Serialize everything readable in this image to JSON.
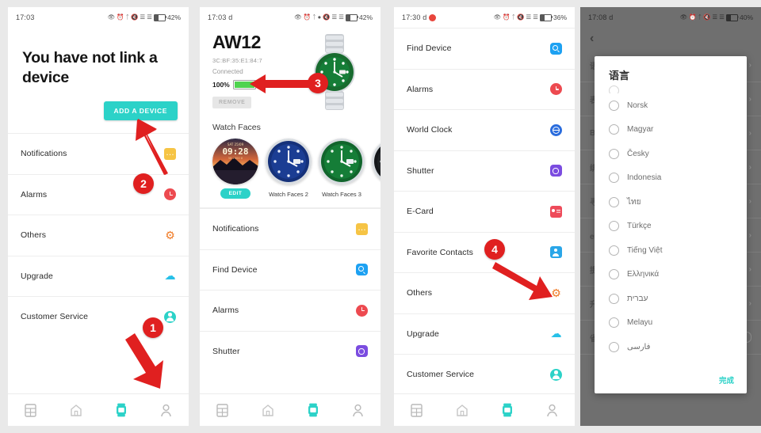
{
  "accent": "#2cd2c8",
  "annotation_color": "#e02020",
  "panel1": {
    "statusbar": {
      "time": "17:03",
      "battery": "42%"
    },
    "headline": "You have not link a device",
    "add_button": "ADD A DEVICE",
    "rows": [
      {
        "label": "Notifications",
        "icon": "notifications-icon"
      },
      {
        "label": "Alarms",
        "icon": "alarm-clock-icon"
      },
      {
        "label": "Others",
        "icon": "gear-icon"
      },
      {
        "label": "Upgrade",
        "icon": "cloud-upload-icon"
      },
      {
        "label": "Customer Service",
        "icon": "person-support-icon"
      }
    ],
    "annotations": [
      {
        "number": "1"
      },
      {
        "number": "2"
      }
    ]
  },
  "panel2": {
    "statusbar": {
      "time": "17:03 d",
      "battery": "42%"
    },
    "device": {
      "name": "AW12",
      "mac": "3C:BF:35:E1:84:7",
      "status": "Connected",
      "battery_percent": "100%",
      "remove_button": "REMOVE"
    },
    "watch_faces_title": "Watch Faces",
    "watch_faces": [
      {
        "caption": "EDIT",
        "is_edit": true,
        "style": "sunset"
      },
      {
        "caption": "Watch Faces 2",
        "is_edit": false,
        "style": "blue"
      },
      {
        "caption": "Watch Faces 3",
        "is_edit": false,
        "style": "green"
      },
      {
        "caption": "W",
        "is_edit": false,
        "style": "dark"
      }
    ],
    "rows": [
      {
        "label": "Notifications",
        "icon": "notifications-icon"
      },
      {
        "label": "Find Device",
        "icon": "find-device-icon"
      },
      {
        "label": "Alarms",
        "icon": "alarm-clock-icon"
      },
      {
        "label": "Shutter",
        "icon": "camera-shutter-icon"
      }
    ],
    "annotations": [
      {
        "number": "3"
      }
    ]
  },
  "panel3": {
    "statusbar": {
      "time": "17:30 d",
      "battery": "36%"
    },
    "rows": [
      {
        "label": "Find Device",
        "icon": "find-device-icon"
      },
      {
        "label": "Alarms",
        "icon": "alarm-clock-icon"
      },
      {
        "label": "World Clock",
        "icon": "world-clock-icon"
      },
      {
        "label": "Shutter",
        "icon": "camera-shutter-icon"
      },
      {
        "label": "E-Card",
        "icon": "e-card-icon"
      },
      {
        "label": "Favorite Contacts",
        "icon": "favorite-contacts-icon"
      },
      {
        "label": "Others",
        "icon": "gear-icon"
      },
      {
        "label": "Upgrade",
        "icon": "cloud-upload-icon"
      },
      {
        "label": "Customer Service",
        "icon": "person-support-icon"
      }
    ],
    "annotations": [
      {
        "number": "4"
      }
    ]
  },
  "panel4": {
    "statusbar": {
      "time": "17:08 d",
      "battery": "40%"
    },
    "back_icon": "chevron-left-icon",
    "background_rows": [
      {
        "label": "语言"
      },
      {
        "label": "表盘"
      },
      {
        "label": "B"
      },
      {
        "label": "绑定"
      },
      {
        "label": "寻找"
      },
      {
        "label": "e卡片"
      },
      {
        "label": "提醒"
      },
      {
        "label": "升级"
      },
      {
        "label": "省电模式"
      }
    ],
    "dialog": {
      "title": "语言",
      "options": [
        "Norsk",
        "Magyar",
        "Česky",
        "Indonesia",
        "ไทย",
        "Türkçe",
        "Tiếng Việt",
        "Ελληνικά",
        "עברית",
        "Melayu",
        "فارسی"
      ],
      "done_button": "完成"
    }
  },
  "tabbar": {
    "tabs": [
      {
        "name": "tab-list",
        "icon": "list-card-icon",
        "active": false
      },
      {
        "name": "tab-home",
        "icon": "home-icon",
        "active": false
      },
      {
        "name": "tab-device",
        "icon": "watch-device-icon",
        "active": true
      },
      {
        "name": "tab-profile",
        "icon": "person-icon",
        "active": false
      }
    ]
  }
}
